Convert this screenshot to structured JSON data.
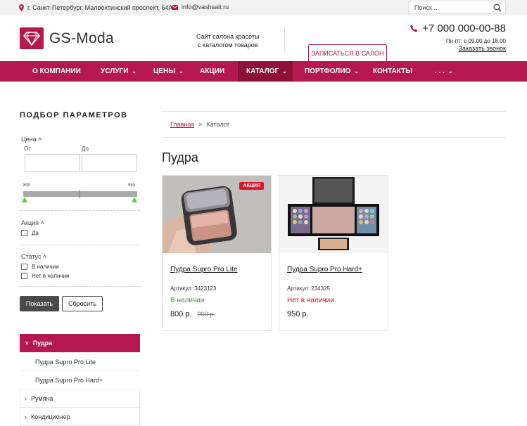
{
  "topbar": {
    "address": "г. Санкт-Петербург, Малоохтинский проспект, 64А",
    "email": "info@vashsait.ru",
    "search_placeholder": "Поиск..."
  },
  "header": {
    "logo_text": "GS-Moda",
    "tagline_line1": "Сайт салона красоты",
    "tagline_line2": "с каталогом товаров",
    "signup_label": "ЗАПИСАТЬСЯ В САЛОН",
    "phone": "+7 000 000-00-88",
    "hours": "Пн-пт: с 09.00 до 18.00",
    "callback": "Заказать звонок"
  },
  "nav": {
    "items": [
      {
        "label": "О КОМПАНИИ"
      },
      {
        "label": "УСЛУГИ"
      },
      {
        "label": "ЦЕНЫ"
      },
      {
        "label": "АКЦИИ"
      },
      {
        "label": "КАТАЛОГ"
      },
      {
        "label": "ПОРТФОЛИО"
      },
      {
        "label": "КОНТАКТЫ"
      },
      {
        "label": ". . ."
      }
    ]
  },
  "filter": {
    "title": "ПОДБОР ПАРАМЕТРОВ",
    "price_label": "Цена",
    "from_label": "От",
    "to_label": "До",
    "min_value": "800",
    "max_value": "950",
    "promo_label": "Акция",
    "promo_yes": "Да",
    "status_label": "Статус",
    "in_stock": "В наличии",
    "out_of_stock": "Нет в наличии",
    "show_button": "Показать",
    "reset_button": "Сбросить"
  },
  "categories": {
    "active": "Пудра",
    "sub1": "Пудра Supro Pro Lite",
    "sub2": "Пудра Supro Pro Hard+",
    "item2": "Румяна",
    "item3": "Кондиционер"
  },
  "breadcrumb": {
    "home": "Главная",
    "separator": ">",
    "current": "Каталог"
  },
  "page_title": "Пудра",
  "products": [
    {
      "name": "Пудра Supro Pro Lite",
      "sku": "Артикул: 3423123",
      "stock": "В наличии",
      "price": "800 р.",
      "old_price": "900 р.",
      "badge": "АКЦИЯ",
      "stock_color": "#3aa02b"
    },
    {
      "name": "Пудра Supro Pro Hard+",
      "sku": "Артикул: 234325",
      "stock": "Нет в наличии",
      "price": "950 р.",
      "stock_color": "#d8172b"
    }
  ],
  "colors": {
    "brand": "#b5184f",
    "nav_active": "#8c1138",
    "slider_handle": "#6cc24a"
  }
}
